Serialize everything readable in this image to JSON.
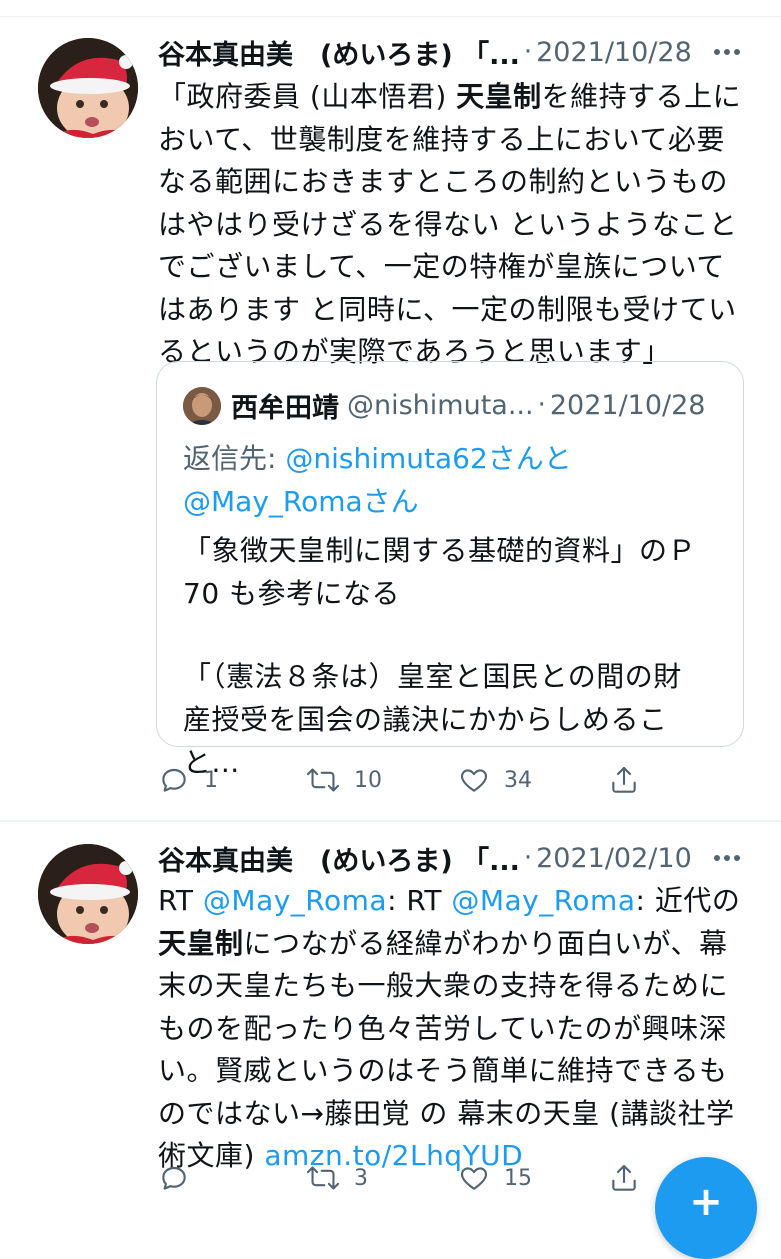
{
  "tweet1": {
    "author_name": "谷本真由美　(めいろま) 「...",
    "dot": "·",
    "date": "2021/10/28",
    "text_part1": "「政府委員 (山本悟君) ",
    "text_bold": "天皇制",
    "text_part2": "を維持する上において、世襲制度を維持する上において必要なる範囲におきますところの制約というものはやはり受けざるを得ない というようなことでございまして、一定の特権が皇族についてはあります と同時に、一定の制限も受けているというのが実際であろうと思います」",
    "quote": {
      "author_name": "西牟田靖",
      "handle": "@nishimuta...",
      "dot": "·",
      "date": "2021/10/28",
      "reply_prefix": "返信先: ",
      "reply_user1": "@nishimuta62",
      "reply_mid": "さんと",
      "reply_user2": "@May_Roma",
      "reply_suffix": "さん",
      "text_line1": "「象徴天皇制に関する基礎的資料」のＰ",
      "text_line2": "70 も参考になる",
      "text_line3": "「（憲法８条は）皇室と国民との間の財",
      "text_line4": "産授受を国会の議決にかからしめること..."
    },
    "replies": "1",
    "retweets": "10",
    "likes": "34"
  },
  "tweet2": {
    "author_name": "谷本真由美　(めいろま) 「...",
    "dot": "·",
    "date": "2021/02/10",
    "rt1": "RT ",
    "mention1": "@May_Roma",
    "rt2": ": RT ",
    "mention2": "@May_Roma",
    "text_a": ": 近代の",
    "text_bold": "天皇制",
    "text_b": "につながる経緯がわかり面白いが、幕末の天皇たちも一般大衆の支持を得るためにものを配ったり色々苦労していたのが興味深い。賢威というのはそう簡単に維持できるものではない→藤田覚 の 幕末の天皇 (講談社学術文庫) ",
    "link": "amzn.to/2LhqYUD",
    "replies": "",
    "retweets": "3",
    "likes": "15"
  },
  "fab_label": "+"
}
